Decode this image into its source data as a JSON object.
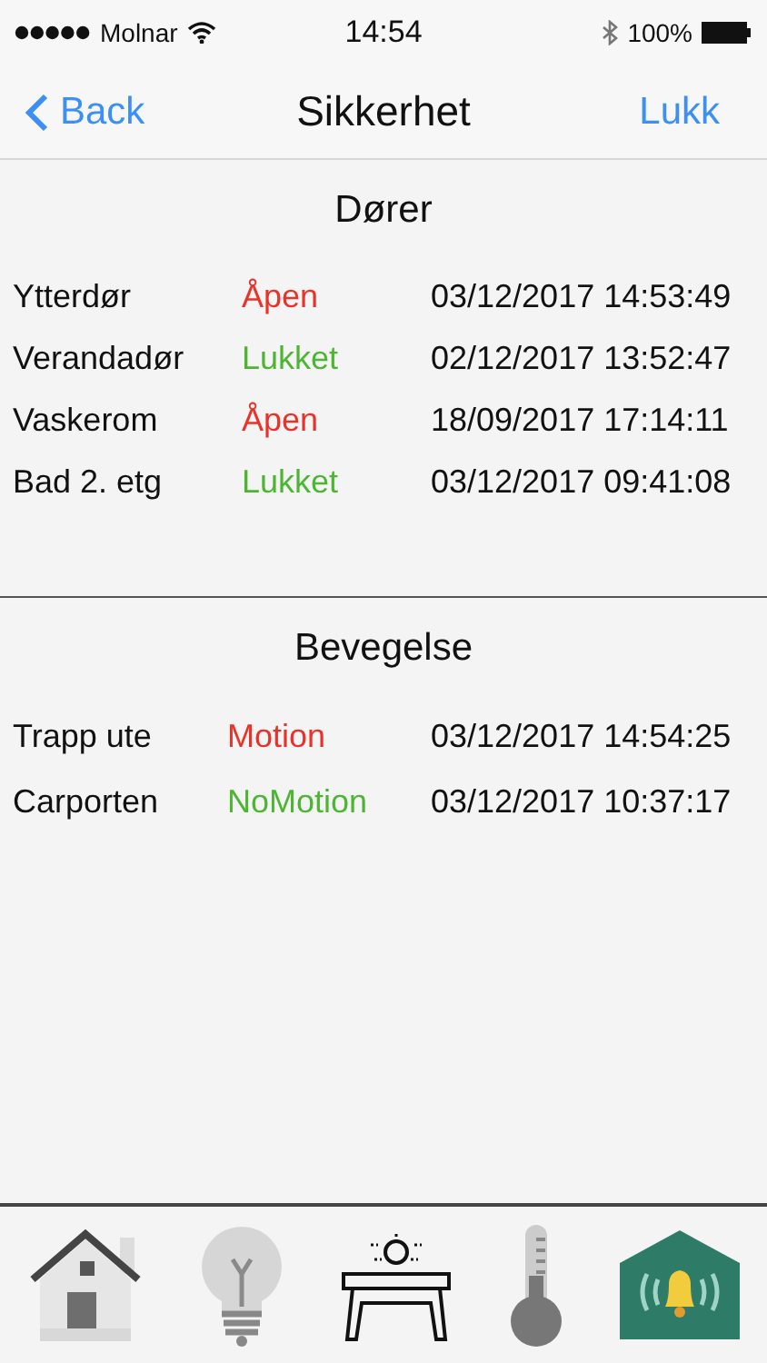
{
  "status_bar": {
    "carrier": "Molnar",
    "time": "14:54",
    "battery": "100%"
  },
  "nav": {
    "back": "Back",
    "title": "Sikkerhet",
    "action": "Lukk"
  },
  "sections": [
    {
      "title": "Dører",
      "rows": [
        {
          "name": "Ytterdør",
          "status": "Åpen",
          "color": "#e8322a",
          "time": "03/12/2017 14:53:49"
        },
        {
          "name": "Verandadør",
          "status": "Lukket",
          "color": "#4cb632",
          "time": "02/12/2017 13:52:47"
        },
        {
          "name": "Vaskerom",
          "status": "Åpen",
          "color": "#e8322a",
          "time": "18/09/2017 17:14:11"
        },
        {
          "name": "Bad 2. etg",
          "status": "Lukket",
          "color": "#4cb632",
          "time": "03/12/2017 09:41:08"
        }
      ]
    },
    {
      "title": "Bevegelse",
      "rows": [
        {
          "name": "Trapp ute",
          "status": "Motion",
          "color": "#e8322a",
          "time": "03/12/2017 14:54:25"
        },
        {
          "name": "Carporten",
          "status": "NoMotion",
          "color": "#4cb632",
          "time": "03/12/2017 10:37:17"
        }
      ]
    }
  ],
  "tabs": [
    {
      "kind": "home"
    },
    {
      "kind": "bulb"
    },
    {
      "kind": "table"
    },
    {
      "kind": "thermometer"
    },
    {
      "kind": "alarm"
    }
  ]
}
